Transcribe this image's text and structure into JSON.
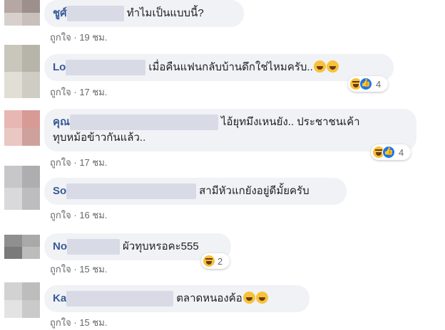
{
  "comments": [
    {
      "author": "ชูศ์",
      "text": "ทำไมเป็นแบบนี้?",
      "like_label": "ถูกใจ",
      "separator": "·",
      "time": "19 ชม.",
      "avatar_colors": [
        "#b6a7a3",
        "#9c8f8c",
        "#d8d0cc",
        "#c9c0bc"
      ]
    },
    {
      "author": "Lo",
      "text": "เมื่อคืนแฟนกลับบ้านดึกใช่ไหมครับ..",
      "like_label": "ถูกใจ",
      "separator": "·",
      "time": "17 ชม.",
      "reaction_count": "4",
      "reactions": [
        "laugh-emoji",
        "like-emoji"
      ],
      "avatar_colors": [
        "#c9c6bc",
        "#b7b4aa",
        "#e1ded5",
        "#cfccc3"
      ]
    },
    {
      "author": "คุณ",
      "text_line1": "ไอ้ยุทมึงเหนยัง.. ประชาชนเค้า",
      "text_line2": "ทุบหม้อข้าวกันแล้ว..",
      "like_label": "ถูกใจ",
      "separator": "·",
      "time": "17 ชม.",
      "reaction_count": "4",
      "reactions": [
        "laugh-emoji",
        "like-emoji"
      ],
      "avatar_colors": [
        "#e7b7b3",
        "#d79a95",
        "#e9c7c3",
        "#cfa19c"
      ]
    },
    {
      "author": "So",
      "text": "สามีหัวแกยังอยู่ดีมั้ยครับ",
      "like_label": "ถูกใจ",
      "separator": "·",
      "time": "16 ชม.",
      "avatar_colors": [
        "#c7c7c9",
        "#aeaeb0",
        "#d9d9db",
        "#bdbdc0"
      ]
    },
    {
      "author": "No",
      "text": "ผัวทุบหรอคะ555",
      "like_label": "ถูกใจ",
      "separator": "·",
      "time": "15 ชม.",
      "reaction_count": "2",
      "reactions": [
        "laugh-emoji"
      ],
      "avatar_colors": [
        "#8f8f8f",
        "#a9a9a9",
        "#7a7a7a",
        "#bcbcbc"
      ]
    },
    {
      "author": "Ka",
      "text": "ตลาดหนองค้อ",
      "like_label": "ถูกใจ",
      "separator": "·",
      "time": "15 ชม.",
      "avatar_colors": [
        "#d2d2d2",
        "#bdbdbd",
        "#e3e3e3",
        "#cacaca"
      ]
    }
  ]
}
